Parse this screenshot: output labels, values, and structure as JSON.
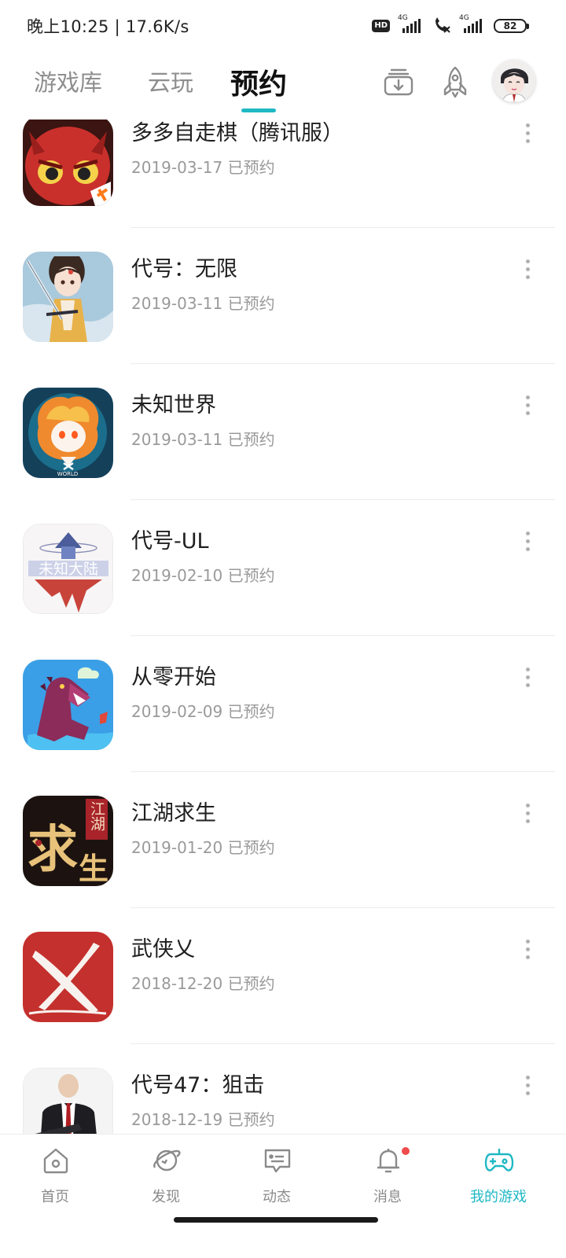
{
  "status_bar": {
    "time": "晚上10:25 | 17.6K/s",
    "hd": "HD",
    "sim1": "4G",
    "sim2": "4G",
    "battery": "82"
  },
  "header": {
    "tabs": [
      {
        "label": "游戏库"
      },
      {
        "label": "云玩"
      },
      {
        "label": "预约",
        "active": true
      }
    ],
    "accent_color": "#1fb8c4",
    "icons": [
      "download-icon",
      "rocket-icon",
      "avatar"
    ]
  },
  "reservations": [
    {
      "title": "多多自走棋（腾讯服）",
      "subtitle": "2019-03-17 已预约",
      "icon": "red-creature-app-icon"
    },
    {
      "title": "代号：无限",
      "subtitle": "2019-03-11 已预约",
      "icon": "swordswoman-app-icon"
    },
    {
      "title": "未知世界",
      "subtitle": "2019-03-11 已预约",
      "icon": "fire-spirit-app-icon"
    },
    {
      "title": "代号-UL",
      "subtitle": "2019-02-10 已预约",
      "icon": "floating-castle-app-icon"
    },
    {
      "title": "从零开始",
      "subtitle": "2019-02-09 已预约",
      "icon": "dinosaur-app-icon"
    },
    {
      "title": "江湖求生",
      "subtitle": "2019-01-20 已预约",
      "icon": "calligraphy-app-icon"
    },
    {
      "title": "武侠乂",
      "subtitle": "2018-12-20 已预约",
      "icon": "red-slash-app-icon"
    },
    {
      "title": "代号47：狙击",
      "subtitle": "2018-12-19 已预约",
      "icon": "agent-47-app-icon"
    }
  ],
  "icon_text": {
    "unknown_continent": "未知大陆",
    "world": "WORLD",
    "jianghu": "江湖",
    "qiu": "求",
    "sheng": "生"
  },
  "bottom_nav": [
    {
      "label": "首页",
      "icon": "home-icon"
    },
    {
      "label": "发现",
      "icon": "planet-icon"
    },
    {
      "label": "动态",
      "icon": "message-icon"
    },
    {
      "label": "消息",
      "icon": "bell-icon",
      "badge": true
    },
    {
      "label": "我的游戏",
      "icon": "gamepad-icon",
      "active": true
    }
  ]
}
